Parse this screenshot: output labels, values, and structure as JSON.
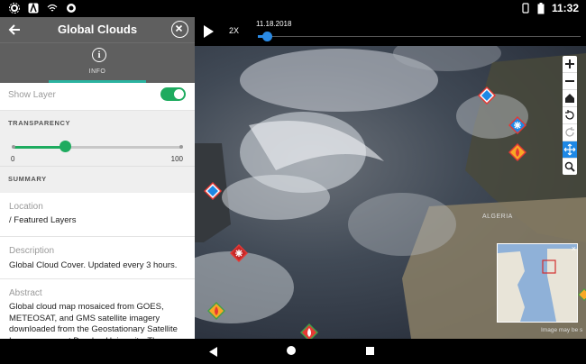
{
  "status_bar": {
    "time": "11:32"
  },
  "panel": {
    "title": "Global Clouds",
    "tab_info": "INFO",
    "show_layer_label": "Show Layer",
    "transparency": {
      "title": "TRANSPARENCY",
      "value_percent": 32,
      "min_label": "0",
      "max_label": "100"
    },
    "summary_title": "SUMMARY",
    "location": {
      "label": "Location",
      "value": "/ Featured Layers"
    },
    "description": {
      "label": "Description",
      "value": "Global Cloud Cover. Updated every 3 hours."
    },
    "abstract": {
      "label": "Abstract",
      "value": "Global cloud map mosaiced from GOES, METEOSAT, and GMS satellite imagery downloaded from the Geostationary Satellite Imagery page at Dundee University. The map is"
    }
  },
  "timebar": {
    "speed": "2X",
    "date": "11.18.2018",
    "position_fraction": 0.04
  },
  "map": {
    "labels": {
      "algeria": "ALGERIA"
    },
    "attribution": "Image may be s",
    "minimap_close": "×"
  },
  "colors": {
    "accent_green": "#1eab5f",
    "timeline_blue": "#2a8be6",
    "panel_header": "#5f5f5f"
  },
  "icons": [
    "back-arrow-icon",
    "close-icon",
    "info-icon",
    "play-icon",
    "zoom-in-icon",
    "zoom-out-icon",
    "home-icon",
    "rotate-left-icon",
    "rotate-right-icon",
    "move-icon",
    "search-icon",
    "weather-warning-icon"
  ]
}
